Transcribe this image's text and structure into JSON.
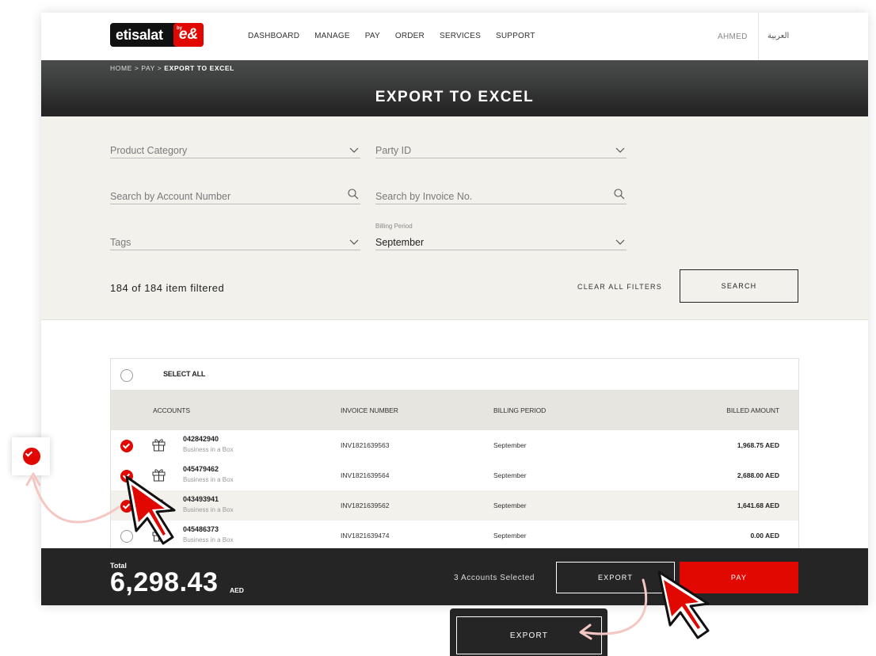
{
  "header": {
    "logo_text": "etisalat",
    "logo_badge": "e&",
    "logo_badge_small": "by",
    "nav": [
      "DASHBOARD",
      "MANAGE",
      "PAY",
      "ORDER",
      "SERVICES",
      "SUPPORT"
    ],
    "user": "AHMED",
    "language": "العربية"
  },
  "breadcrumb": {
    "items": [
      "HOME >",
      "PAY >"
    ],
    "current": "EXPORT TO EXCEL"
  },
  "page_title": "EXPORT TO EXCEL",
  "filters": {
    "product_category": "Product Category",
    "party_id": "Party ID",
    "search_account_placeholder": "Search by Account Number",
    "search_invoice_placeholder": "Search by Invoice No.",
    "tags": "Tags",
    "billing_period_label": "Billing Period",
    "billing_period_value": "September",
    "count_text": "184 of 184 item filtered",
    "clear_all": "CLEAR ALL FILTERS",
    "search_button": "SEARCH"
  },
  "table": {
    "select_all": "SELECT ALL",
    "headers": [
      "ACCOUNTS",
      "INVOICE NUMBER",
      "BILLING PERIOD",
      "BILLED AMOUNT"
    ],
    "rows": [
      {
        "checked": true,
        "account": "042842940",
        "type": "Business in a Box",
        "invoice": "INV1821639563",
        "period": "September",
        "amount": "1,968.75 AED"
      },
      {
        "checked": true,
        "account": "045479462",
        "type": "Business in a Box",
        "invoice": "INV1821639564",
        "period": "September",
        "amount": "2,688.00 AED"
      },
      {
        "checked": true,
        "account": "043493941",
        "type": "Business in a Box",
        "invoice": "INV1821639562",
        "period": "September",
        "amount": "1,641.68 AED"
      },
      {
        "checked": false,
        "account": "045486373",
        "type": "Business in a Box",
        "invoice": "INV1821639474",
        "period": "September",
        "amount": "0.00 AED"
      }
    ]
  },
  "footer": {
    "total_label": "Total",
    "total_value": "6,298.43",
    "currency": "AED",
    "selected_text": "3 Accounts Selected",
    "export_button": "EXPORT",
    "pay_button": "PAY"
  },
  "callout": {
    "export_button": "EXPORT"
  },
  "colors": {
    "accent": "#e00800",
    "dark": "#252525",
    "panel": "#f2f1ec",
    "header_row": "#e6e5df"
  }
}
